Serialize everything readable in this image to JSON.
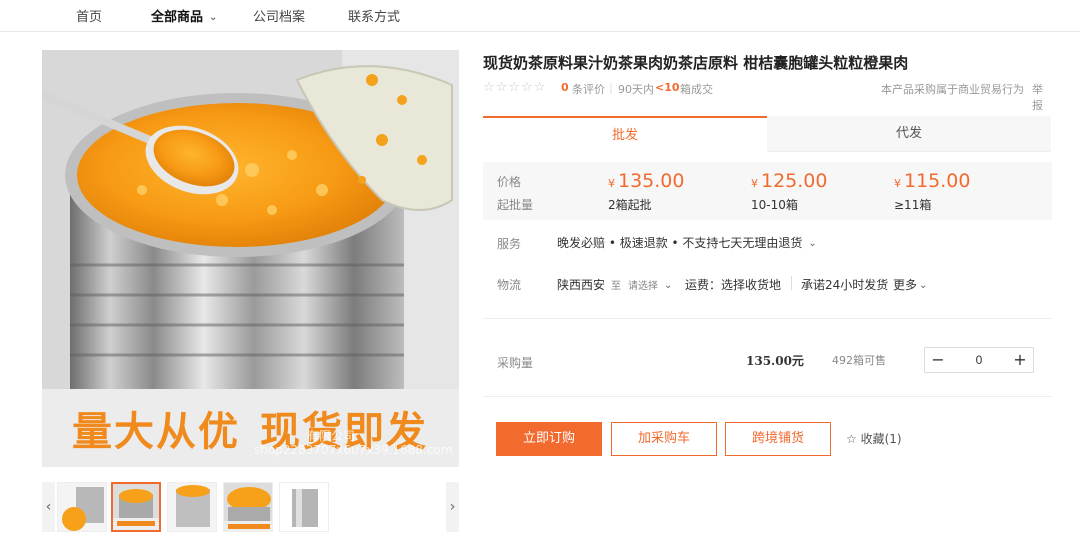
{
  "nav": {
    "items": [
      "首页",
      "全部商品",
      "公司档案",
      "联系方式"
    ]
  },
  "product": {
    "title": "现货奶茶原料果汁奶茶果肉奶茶店原料 柑桔囊胞罐头粒粒橙果肉",
    "banner_left": "量大从优",
    "banner_right": "现货即发",
    "watermark_line1": "有限公司",
    "watermark_line2": "shop2283707x6u7x39.1688.com",
    "rating": {
      "stars": "☆☆☆☆☆",
      "review_count": "0",
      "review_label": "条评价",
      "sold_label": "90天内",
      "sold_count": "<10",
      "sold_unit": "箱成交"
    },
    "trade_note": "本产品采购属于商业贸易行为",
    "report_label": "举报"
  },
  "tabs": [
    "批发",
    "代发"
  ],
  "price_box": {
    "price_label": "价格",
    "qty_label": "起批量",
    "currency": "¥",
    "tiers": [
      {
        "price": "135.00",
        "qty": "2箱起批"
      },
      {
        "price": "125.00",
        "qty": "10-10箱"
      },
      {
        "price": "115.00",
        "qty": "≥11箱"
      }
    ]
  },
  "service": {
    "label": "服务",
    "text": "晚发必赔 • 极速退款 • 不支持七天无理由退货"
  },
  "logistics": {
    "label": "物流",
    "origin": "陕西西安",
    "to": "至",
    "select_placeholder": "请选择",
    "shipping_fee": "运费：选择收货地",
    "promise": "承诺24小时发货",
    "more": "更多"
  },
  "purchase": {
    "label": "采购量",
    "unit_price": "135.00元",
    "stock": "492箱可售",
    "quantity": "0",
    "minus": "−",
    "plus": "+"
  },
  "actions": {
    "order": "立即订购",
    "cart": "加采购车",
    "cross_border": "跨境铺货",
    "favorite": "收藏(1)"
  },
  "colors": {
    "accent": "#f26a2e",
    "banner_text": "#f08a1c"
  },
  "icons": {
    "chevron": "chevron-down-icon",
    "star": "star-icon",
    "prev": "chevron-left-icon",
    "next": "chevron-right-icon"
  }
}
